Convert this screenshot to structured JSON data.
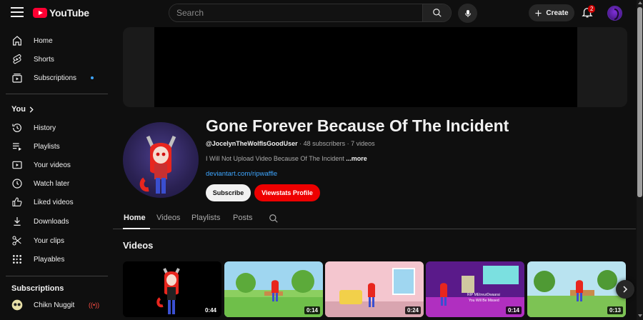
{
  "header": {
    "logo_text": "YouTube",
    "search_placeholder": "Search",
    "create_label": "Create",
    "notification_count": "2"
  },
  "sidebar": {
    "main": [
      {
        "label": "Home",
        "icon": "home-icon"
      },
      {
        "label": "Shorts",
        "icon": "shorts-icon"
      },
      {
        "label": "Subscriptions",
        "icon": "subscriptions-icon"
      }
    ],
    "you_heading": "You",
    "you_items": [
      {
        "label": "History",
        "icon": "history-icon"
      },
      {
        "label": "Playlists",
        "icon": "playlists-icon"
      },
      {
        "label": "Your videos",
        "icon": "your-videos-icon"
      },
      {
        "label": "Watch later",
        "icon": "clock-icon"
      },
      {
        "label": "Liked videos",
        "icon": "thumbs-up-icon"
      },
      {
        "label": "Downloads",
        "icon": "download-icon"
      },
      {
        "label": "Your clips",
        "icon": "scissors-icon"
      },
      {
        "label": "Playables",
        "icon": "playables-icon"
      }
    ],
    "subscriptions_heading": "Subscriptions",
    "subscriptions": [
      {
        "label": "Chikn Nuggit"
      }
    ]
  },
  "channel": {
    "title": "Gone Forever Because Of The Incident",
    "handle": "@JocelynTheWolfIsGoodUser",
    "stats": " · 48 subscribers · 7 videos",
    "description": "I Will Not Upload Video Because Of The Incident ",
    "more_label": "...more",
    "link": "deviantart.com/ripwaffle",
    "subscribe_label": "Subscribe",
    "viewstats_label": "Viewstats Profile"
  },
  "tabs": [
    "Home",
    "Videos",
    "Playlists",
    "Posts"
  ],
  "section_title": "Videos",
  "videos": [
    {
      "duration": "0:44"
    },
    {
      "duration": "0:14"
    },
    {
      "duration": "0:24"
    },
    {
      "duration": "0:14",
      "overlay_text_1": "RIP MEtreurDwaarai",
      "overlay_text_2": "You Will Be Missed"
    },
    {
      "duration": "0:13"
    }
  ],
  "colors": {
    "background": "#0f0f0f",
    "accent_red": "#ee0000",
    "link_blue": "#3ea6ff"
  }
}
